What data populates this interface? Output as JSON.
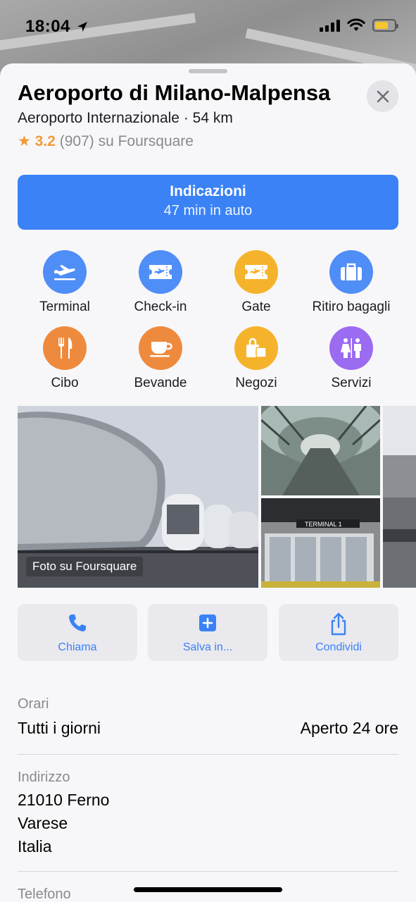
{
  "status_bar": {
    "time": "18:04"
  },
  "place": {
    "title": "Aeroporto di Milano-Malpensa",
    "subtitle": "Aeroporto Internazionale · 54 km",
    "rating_score": "3.2",
    "rating_rest": "(907) su Foursquare"
  },
  "directions": {
    "label": "Indicazioni",
    "sub": "47 min in auto"
  },
  "categories": [
    {
      "label": "Terminal",
      "icon": "airplane-departure-icon",
      "color": "#4f8ef7"
    },
    {
      "label": "Check-in",
      "icon": "ticket-icon",
      "color": "#4f8ef7"
    },
    {
      "label": "Gate",
      "icon": "ticket-icon",
      "color": "#f5b32c"
    },
    {
      "label": "Ritiro bagagli",
      "icon": "suitcase-icon",
      "color": "#4f8ef7"
    },
    {
      "label": "Cibo",
      "icon": "fork-knife-icon",
      "color": "#ee8a3d"
    },
    {
      "label": "Bevande",
      "icon": "cup-icon",
      "color": "#ee8a3d"
    },
    {
      "label": "Negozi",
      "icon": "shopping-bag-icon",
      "color": "#f5b32c"
    },
    {
      "label": "Servizi",
      "icon": "restroom-icon",
      "color": "#9b6bf2"
    }
  ],
  "photos": {
    "credit": "Foto su Foursquare"
  },
  "actions": {
    "call": "Chiama",
    "save": "Salva in...",
    "share": "Condividi"
  },
  "info": {
    "hours_label": "Orari",
    "hours_days": "Tutti i giorni",
    "hours_value": "Aperto 24 ore",
    "address_label": "Indirizzo",
    "address_line1": "21010 Ferno",
    "address_line2": "Varese",
    "address_line3": "Italia",
    "phone_label": "Telefono"
  },
  "colors": {
    "accent": "#3a82f6",
    "star": "#f09a37"
  }
}
